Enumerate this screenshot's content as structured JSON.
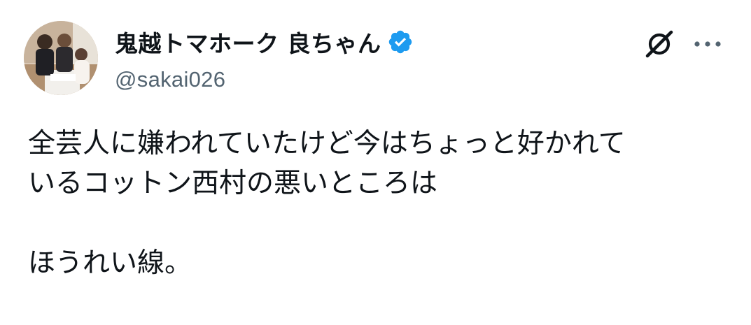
{
  "author": {
    "display_name": "鬼越トマホーク 良ちゃん",
    "handle": "@sakai026",
    "verified": true,
    "avatar": "avatar-photo"
  },
  "post": {
    "lines": [
      "全芸人に嫌われていたけど今はちょっと好かれて",
      "いるコットン西村の悪いところは",
      "",
      "ほうれい線。"
    ]
  },
  "icons": {
    "verified": "verified-badge-icon",
    "grok": "grok-icon",
    "more": "more-icon"
  },
  "colors": {
    "text": "#0f1419",
    "secondary": "#536471",
    "verified": "#1d9bf0"
  }
}
